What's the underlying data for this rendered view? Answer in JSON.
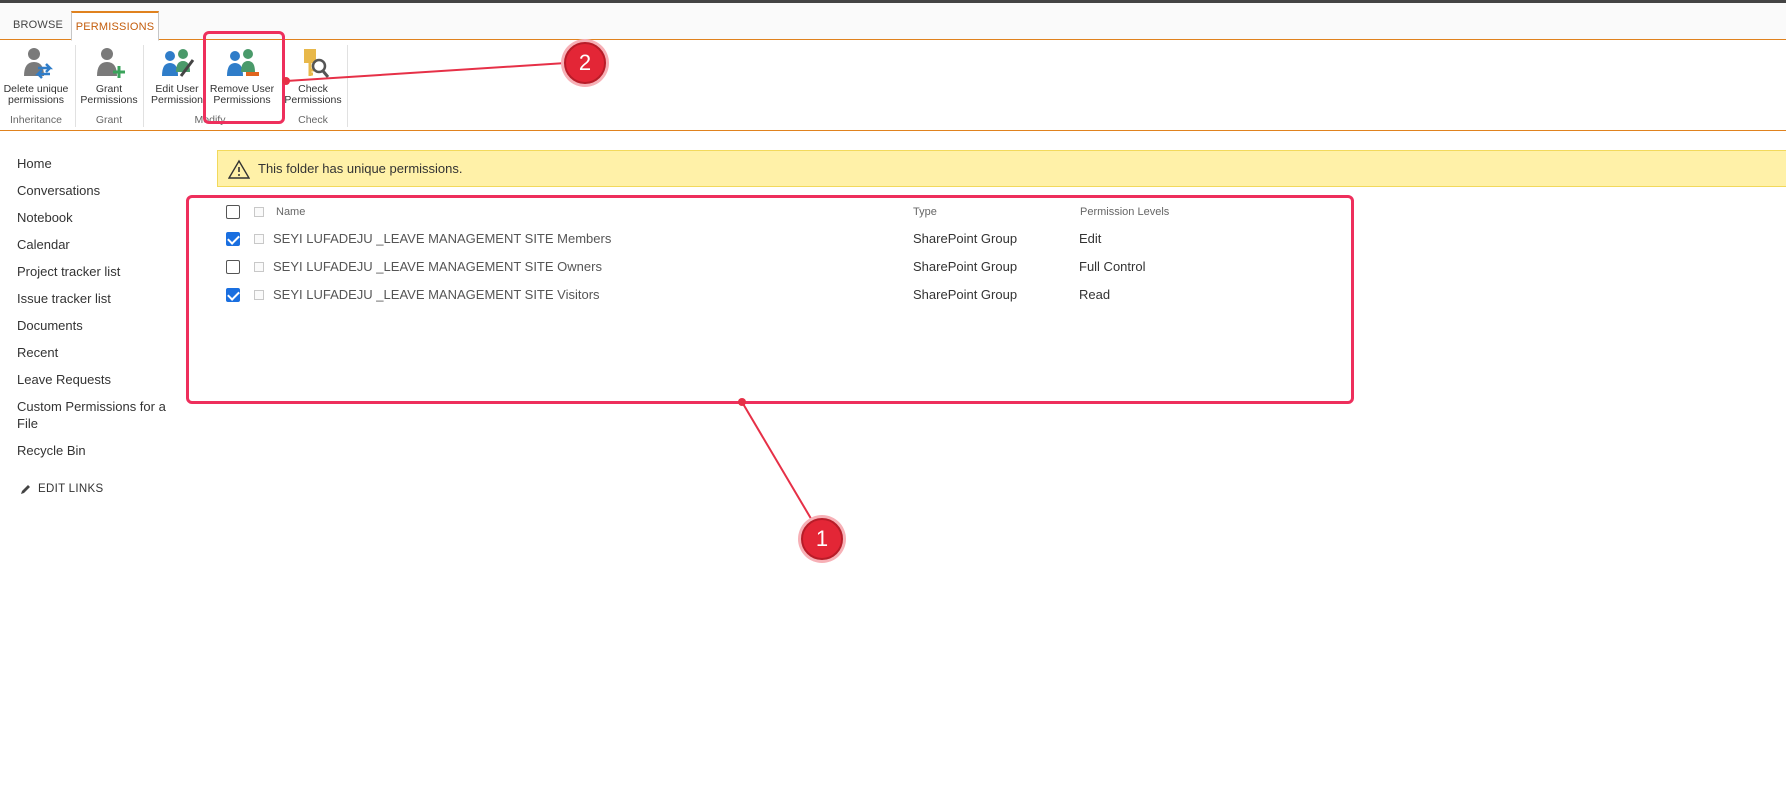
{
  "ribbon": {
    "tabs": [
      "BROWSE",
      "PERMISSIONS"
    ],
    "buttons": {
      "delete_unique": [
        "Delete unique",
        "permissions"
      ],
      "grant": [
        "Grant",
        "Permissions"
      ],
      "edit_user": [
        "Edit User",
        "Permission"
      ],
      "remove_user": [
        "Remove User",
        "Permissions"
      ],
      "check": [
        "Check",
        "Permissions"
      ]
    },
    "groups": {
      "inheritance": "Inheritance",
      "grant": "Grant",
      "modify": "Modify",
      "check": "Check"
    }
  },
  "nav": {
    "items": [
      "Home",
      "Conversations",
      "Notebook",
      "Calendar",
      "Project tracker list",
      "Issue tracker list",
      "Documents",
      "Recent",
      "Leave Requests",
      "Custom Permissions for a File",
      "Recycle Bin"
    ],
    "edit_links": "EDIT LINKS"
  },
  "warning": {
    "text": "This folder has unique permissions."
  },
  "table": {
    "headers": {
      "name": "Name",
      "type": "Type",
      "levels": "Permission Levels"
    },
    "rows": [
      {
        "name": "SEYI LUFADEJU _LEAVE MANAGEMENT SITE Members",
        "type": "SharePoint Group",
        "level": "Edit",
        "checked": true
      },
      {
        "name": "SEYI LUFADEJU _LEAVE MANAGEMENT SITE Owners",
        "type": "SharePoint Group",
        "level": "Full Control",
        "checked": false
      },
      {
        "name": "SEYI LUFADEJU _LEAVE MANAGEMENT SITE Visitors",
        "type": "SharePoint Group",
        "level": "Read",
        "checked": true
      }
    ]
  },
  "annotations": {
    "badge_1": "1",
    "badge_2": "2",
    "color": "#ee2f5c"
  }
}
